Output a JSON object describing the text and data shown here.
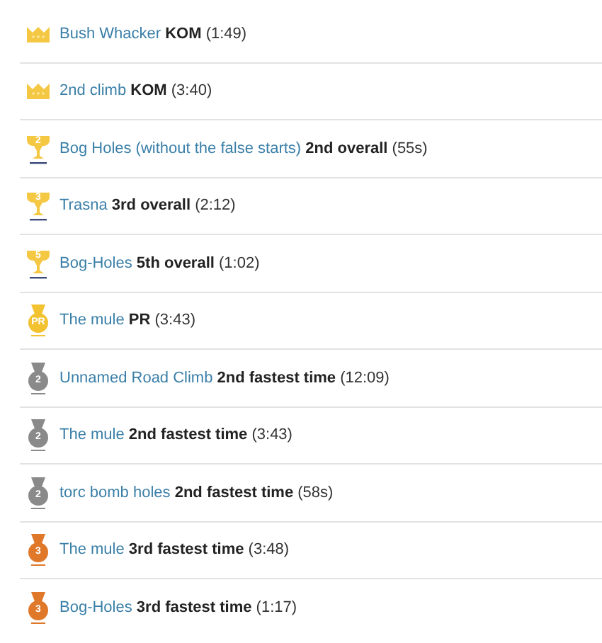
{
  "achievements": [
    {
      "kind": "crown",
      "segment": "Bush Whacker",
      "result": "KOM",
      "time": "(1:49)"
    },
    {
      "kind": "crown",
      "segment": "2nd climb",
      "result": "KOM",
      "time": "(3:40)"
    },
    {
      "kind": "trophy",
      "badge": "2",
      "segment": "Bog Holes (without the false starts)",
      "result": "2nd overall",
      "time": "(55s)"
    },
    {
      "kind": "trophy",
      "badge": "3",
      "segment": "Trasna",
      "result": "3rd overall",
      "time": "(2:12)"
    },
    {
      "kind": "trophy",
      "badge": "5",
      "segment": "Bog-Holes",
      "result": "5th overall",
      "time": "(1:02)"
    },
    {
      "kind": "medal",
      "color": "#f2c230",
      "badge": "PR",
      "segment": "The mule",
      "result": "PR",
      "time": "(3:43)"
    },
    {
      "kind": "medal",
      "color": "#8a8a8a",
      "badge": "2",
      "segment": "Unnamed Road Climb",
      "result": "2nd fastest time",
      "time": "(12:09)"
    },
    {
      "kind": "medal",
      "color": "#8a8a8a",
      "badge": "2",
      "segment": "The mule",
      "result": "2nd fastest time",
      "time": "(3:43)"
    },
    {
      "kind": "medal",
      "color": "#8a8a8a",
      "badge": "2",
      "segment": "torc bomb holes",
      "result": "2nd fastest time",
      "time": "(58s)"
    },
    {
      "kind": "medal",
      "color": "#e0782a",
      "badge": "3",
      "segment": "The mule",
      "result": "3rd fastest time",
      "time": "(3:48)"
    },
    {
      "kind": "medal",
      "color": "#e0782a",
      "badge": "3",
      "segment": "Bog-Holes",
      "result": "3rd fastest time",
      "time": "(1:17)"
    }
  ]
}
